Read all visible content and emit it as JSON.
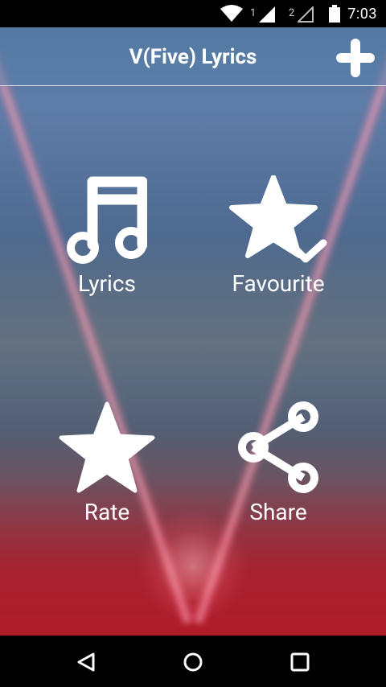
{
  "status_bar": {
    "time": "7:03",
    "sim1_label": "1",
    "sim2_label": "2",
    "icons": [
      "wifi-icon",
      "signal-sim1-icon",
      "signal-sim2-icon",
      "battery-icon"
    ]
  },
  "app_bar": {
    "title": "V(Five) Lyrics",
    "add_icon": "plus-icon"
  },
  "menu": {
    "lyrics": {
      "label": "Lyrics",
      "icon": "music-note-icon"
    },
    "favourite": {
      "label": "Favourite",
      "icon": "star-check-icon"
    },
    "rate": {
      "label": "Rate",
      "icon": "star-icon"
    },
    "share": {
      "label": "Share",
      "icon": "share-icon"
    }
  },
  "nav_bar": {
    "icons": [
      "back-icon",
      "home-icon",
      "recents-icon"
    ]
  },
  "colors": {
    "status_bar_bg": "#000000",
    "text": "#ffffff",
    "app_bar_tint": "#5a82aa"
  }
}
